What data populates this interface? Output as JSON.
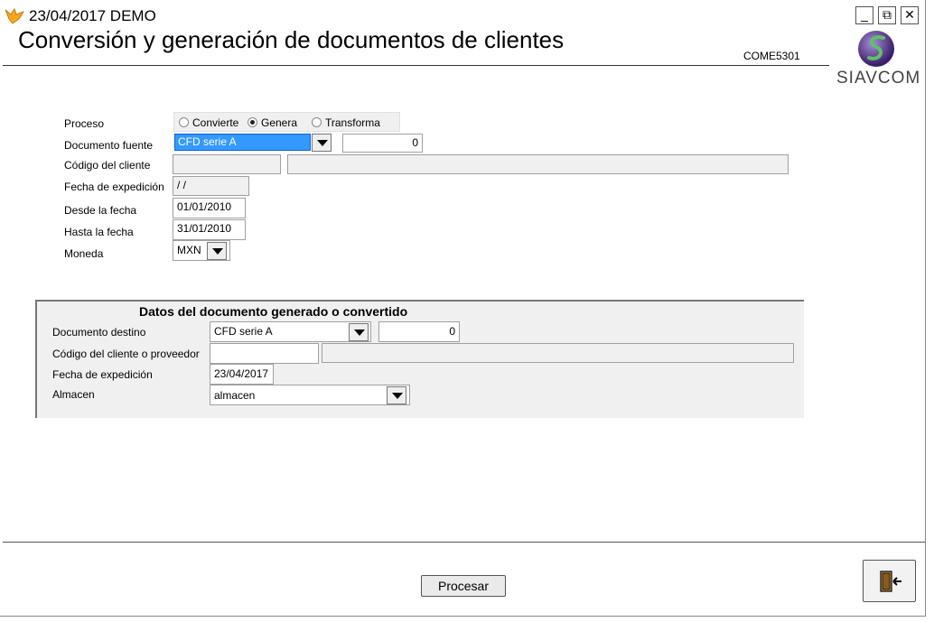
{
  "window": {
    "title": "23/04/2017  DEMO",
    "min": "_",
    "restore": "⧉",
    "close": "✕"
  },
  "header": {
    "page_title": "Conversión y generación de documentos de clientes",
    "form_code": "COME5301",
    "logo_text": "SIAVCOM"
  },
  "form": {
    "proceso_label": "Proceso",
    "radio_convierte": "Convierte",
    "radio_genera": "Genera",
    "radio_transforma": "Transforma",
    "selected_process": "Genera",
    "doc_fuente_label": "Documento fuente",
    "doc_fuente_value": "CFD serie A",
    "doc_fuente_number": "0",
    "codigo_cliente_label": "Código del cliente",
    "codigo_cliente_value": "",
    "codigo_cliente_name": "",
    "fecha_exp_label": "Fecha de expedición",
    "fecha_exp_value": " / /",
    "desde_label": "Desde la fecha",
    "desde_value": "01/01/2010",
    "hasta_label": "Hasta la fecha",
    "hasta_value": "31/01/2010",
    "moneda_label": "Moneda",
    "moneda_value": "MXN"
  },
  "generated": {
    "section_title": "Datos del documento generado o convertido",
    "doc_destino_label": "Documento destino",
    "doc_destino_value": "CFD serie A",
    "doc_destino_number": "0",
    "codigo_label": "Código del cliente o proveedor",
    "codigo_value": "",
    "codigo_name": "",
    "fecha_label": "Fecha de expedición",
    "fecha_value": "23/04/2017",
    "almacen_label": "Almacen",
    "almacen_value": "almacen"
  },
  "footer": {
    "process_button": "Procesar"
  },
  "colors": {
    "selection": "#3399ff",
    "panel": "#f0f0f0",
    "logo_purple": "#4b2a7a",
    "logo_green": "#3c8a4a"
  }
}
